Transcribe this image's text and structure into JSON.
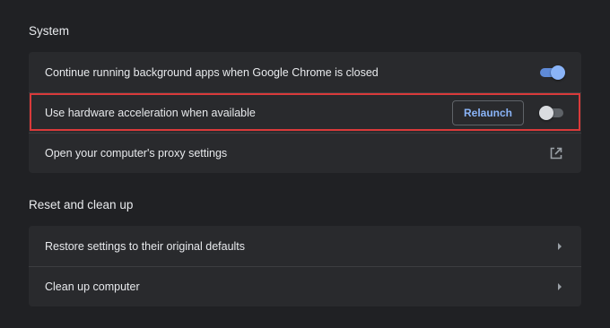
{
  "sections": {
    "system": {
      "title": "System",
      "rows": {
        "background_apps": {
          "label": "Continue running background apps when Google Chrome is closed",
          "toggle": "on"
        },
        "hardware_accel": {
          "label": "Use hardware acceleration when available",
          "button_label": "Relaunch",
          "toggle": "off"
        },
        "proxy": {
          "label": "Open your computer's proxy settings",
          "icon": "open-in-new-icon"
        }
      }
    },
    "reset": {
      "title": "Reset and clean up",
      "rows": {
        "restore": {
          "label": "Restore settings to their original defaults",
          "icon": "chevron-right-icon"
        },
        "cleanup": {
          "label": "Clean up computer",
          "icon": "chevron-right-icon"
        }
      }
    }
  },
  "colors": {
    "background": "#202124",
    "card": "#292a2d",
    "accent": "#8ab4f8",
    "highlight": "#d93a3a"
  }
}
